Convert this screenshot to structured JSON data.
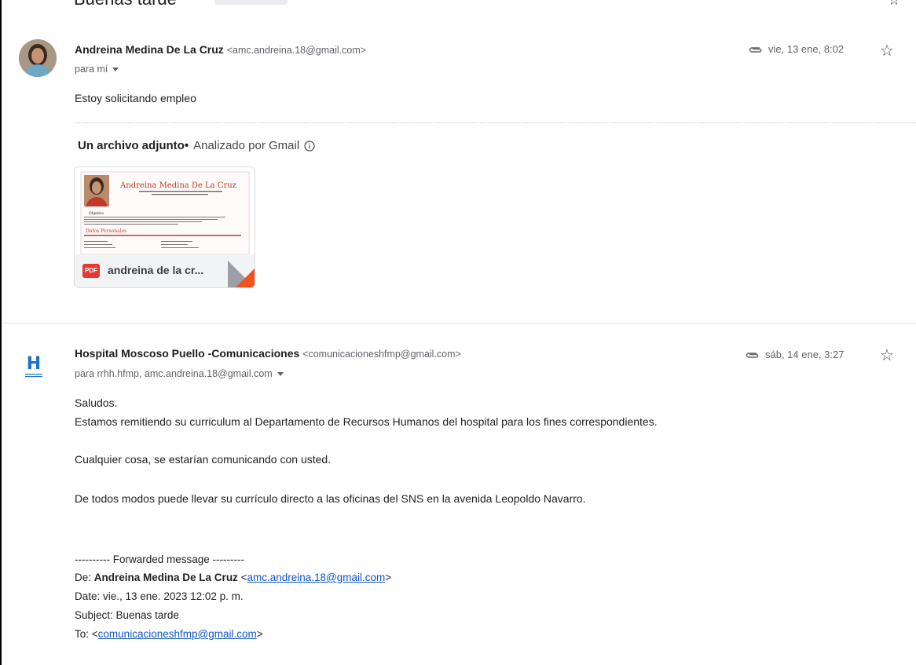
{
  "prev_thread": {
    "subject": "Buenas tarde"
  },
  "message1": {
    "sender_name": "Andreina Medina De La Cruz",
    "sender_email": "<amc.andreina.18@gmail.com>",
    "recipients": "para mí",
    "date": "vie, 13 ene, 8:02",
    "body": "Estoy solicitando empleo",
    "attachments_heading": "Un archivo adjunto",
    "attachments_sep": "•",
    "scanned_text": "Analizado por Gmail",
    "attachment": {
      "file_name": "andreina de la cr...",
      "type_badge": "PDF",
      "preview": {
        "name": "Andreina Medina De La Cruz",
        "section_objective": "Objetivo",
        "section_personal": "Datos Personales"
      }
    }
  },
  "message2": {
    "sender_name": "Hospital Moscoso Puello -Comunicaciones",
    "sender_email": "<comunicacioneshfmp@gmail.com>",
    "recipients": "para rrhh.hfmp, amc.andreina.18@gmail.com",
    "date": "sáb, 14 ene, 3:27",
    "logo_letter": "H",
    "lines": {
      "l1": "Saludos.",
      "l2": "Estamos remitiendo su curriculum al Departamento de Recursos Humanos del hospital para los fines correspondientes.",
      "l3": "Cualquier cosa, se estarían comunicando con usted.",
      "l4": "De todos modos puede llevar su currículo directo a las oficinas del SNS en la avenida Leopoldo Navarro."
    },
    "forwarded": {
      "header": "---------- Forwarded message ---------",
      "from_label": "De:",
      "from_name": "Andreina Medina De La Cruz",
      "from_email": "amc.andreina.18@gmail.com",
      "date_line": "Date: vie., 13 ene. 2023 12:02 p. m.",
      "subject_line": "Subject: Buenas tarde",
      "to_label": "To:",
      "to_email": "comunicacioneshfmp@gmail.com"
    }
  },
  "colors": {
    "link": "#1155cc",
    "pdf_red": "#e53935",
    "hospital_blue": "#1a73c8"
  },
  "icons": [
    "attachment-clip-icon",
    "star-icon",
    "info-icon",
    "pdf-icon",
    "caret-down-icon",
    "hospital-logo"
  ]
}
